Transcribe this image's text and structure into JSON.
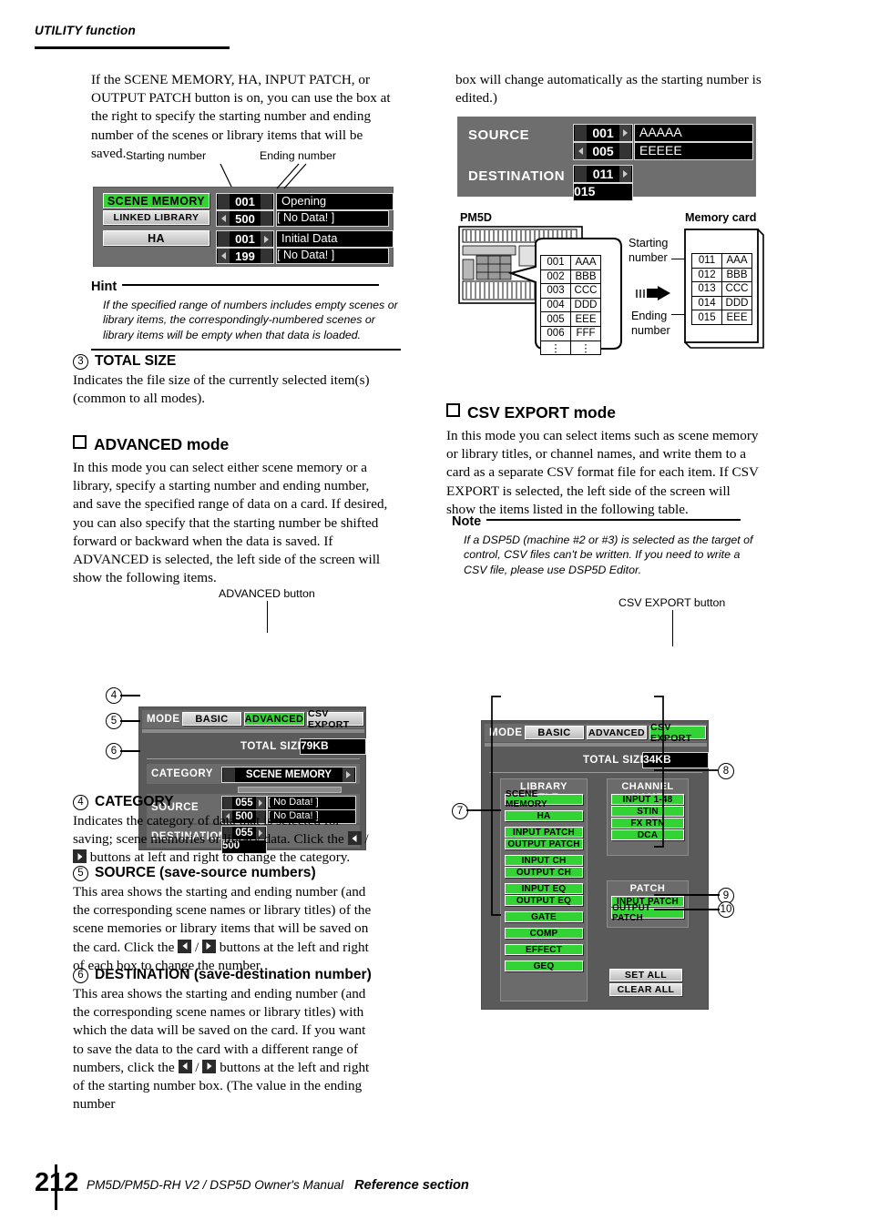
{
  "header": {
    "title": "UTILITY function"
  },
  "left": {
    "intro": "If the SCENE MEMORY, HA, INPUT PATCH, or OUTPUT PATCH button is on, you can use the box at the right to specify the starting number and ending number of the scenes or library items that will be saved.",
    "caption_start": "Starting number",
    "caption_end": "Ending number",
    "screen1": {
      "rows": [
        {
          "button": "SCENE MEMORY",
          "button_state": "on",
          "number": "001",
          "name": "Opening",
          "left_arrow": false,
          "right_arrow": false
        },
        {
          "button": "LINKED LIBRARY",
          "button_state": "off",
          "number": "500",
          "name": "[   No Data!   ]",
          "left_arrow": true,
          "right_arrow": false
        },
        {
          "button": "HA",
          "button_state": "off",
          "number": "001",
          "name": "Initial Data",
          "left_arrow": false,
          "right_arrow": true
        },
        {
          "button": "",
          "button_state": "none",
          "number": "199",
          "name": "[   No Data!   ]",
          "left_arrow": true,
          "right_arrow": false
        }
      ]
    },
    "hint": {
      "title": "Hint",
      "body": "If the specified range of numbers includes empty scenes or library items, the correspondingly-numbered scenes or library items will be empty when that data is loaded."
    },
    "item3": {
      "num": "3",
      "title": "TOTAL SIZE",
      "body": "Indicates the file size of the currently selected item(s) (common to all modes)."
    },
    "advanced": {
      "heading": "ADVANCED mode",
      "body": "In this mode you can select either scene memory or a library, specify a starting number and ending number, and save the specified range of data on a card. If desired, you can also specify that the starting number be shifted forward or backward when the data is saved. If ADVANCED is selected, the left side of the screen will show the following items."
    },
    "advanced_caption": "ADVANCED button",
    "screen2": {
      "mode_label": "MODE",
      "tabs": [
        {
          "label": "BASIC",
          "selected": false
        },
        {
          "label": "ADVANCED",
          "selected": true
        },
        {
          "label": "CSV EXPORT",
          "selected": false
        }
      ],
      "total_size_label": "TOTAL SIZE",
      "total_size_value": "79KB",
      "category_label": "CATEGORY",
      "category_value": "SCENE MEMORY",
      "source_label": "SOURCE",
      "source_rows": [
        {
          "number": "055",
          "name": "[   No Data!   ]",
          "left_arrow": false,
          "right_arrow": true
        },
        {
          "number": "500",
          "name": "[   No Data!   ]",
          "left_arrow": true,
          "right_arrow": false
        }
      ],
      "destination_label": "DESTINATION",
      "destination_rows": [
        {
          "number": "055",
          "left_arrow": false,
          "right_arrow": true
        },
        {
          "number": "500",
          "left_arrow": false,
          "right_arrow": false
        }
      ]
    },
    "callouts": {
      "c4": "4",
      "c5": "5",
      "c6": "6"
    },
    "item4": {
      "num": "4",
      "title": "CATEGORY",
      "body_a": "Indicates the category of data that is selected for saving; scene memories or library data. Click the",
      "body_b": "buttons at left and right to change the category."
    },
    "item5": {
      "num": "5",
      "title": "SOURCE (save-source numbers)",
      "body_a": "This area shows the starting and ending number (and the corresponding scene names or library titles) of the scene memories or library items that will be saved on the card. Click the",
      "body_b": "buttons at the left and right of each box to change the number."
    },
    "item6": {
      "num": "6",
      "title": "DESTINATION (save-destination number)",
      "body_a": "This area shows the starting and ending number (and the corresponding scene names or library titles) with which the data will be saved on the card. If you want to save the data to the card with a different range of numbers, click the",
      "body_b": "buttons at the left and right of the starting number box. (The value in the ending number"
    }
  },
  "right": {
    "intro": "box will change automatically as the starting number is edited.)",
    "screen3": {
      "source_label": "SOURCE",
      "source_rows": [
        {
          "number": "001",
          "name": "AAAAA",
          "left_arrow": false,
          "right_arrow": true
        },
        {
          "number": "005",
          "name": "EEEEE",
          "left_arrow": true,
          "right_arrow": false
        }
      ],
      "destination_label": "DESTINATION",
      "destination_rows": [
        {
          "number": "011",
          "left_arrow": false,
          "right_arrow": true
        },
        {
          "number": "015",
          "left_arrow": false,
          "right_arrow": false
        }
      ]
    },
    "diagram": {
      "pm5d_label": "PM5D",
      "card_label": "Memory card",
      "starting_label": "Starting\nnumber",
      "starting_label_l1": "Starting",
      "starting_label_l2": "number",
      "ending_label_l1": "Ending",
      "ending_label_l2": "number",
      "pm5d_table": [
        [
          "001",
          "AAA"
        ],
        [
          "002",
          "BBB"
        ],
        [
          "003",
          "CCC"
        ],
        [
          "004",
          "DDD"
        ],
        [
          "005",
          "EEE"
        ],
        [
          "006",
          "FFF"
        ],
        [
          "⋮",
          "⋮"
        ]
      ],
      "card_table": [
        [
          "011",
          "AAA"
        ],
        [
          "012",
          "BBB"
        ],
        [
          "013",
          "CCC"
        ],
        [
          "014",
          "DDD"
        ],
        [
          "015",
          "EEE"
        ]
      ]
    },
    "csv": {
      "heading": "CSV EXPORT mode",
      "body": "In this mode you can select items such as scene memory or library titles, or channel names, and write them to a card as a separate CSV format file for each item. If CSV EXPORT is selected, the left side of the screen will show the items listed in the following table."
    },
    "note": {
      "title": "Note",
      "body": "If a DSP5D (machine #2 or #3) is selected as the target of control, CSV files can't be written. If you need to write a CSV file, please use DSP5D Editor."
    },
    "csv_caption": "CSV EXPORT button",
    "screen4": {
      "mode_label": "MODE",
      "tabs": [
        {
          "label": "BASIC",
          "selected": false
        },
        {
          "label": "ADVANCED",
          "selected": false
        },
        {
          "label": "CSV EXPORT",
          "selected": true
        }
      ],
      "total_size_label": "TOTAL SIZE",
      "total_size_value": "34KB",
      "library_title_label": "LIBRARY TITLE",
      "library_items": [
        {
          "label": "SCENE MEMORY",
          "gap_after": true
        },
        {
          "label": "HA",
          "gap_after": true
        },
        {
          "label": "INPUT PATCH",
          "gap_after": false
        },
        {
          "label": "OUTPUT PATCH",
          "gap_after": true
        },
        {
          "label": "INPUT CH",
          "gap_after": false
        },
        {
          "label": "OUTPUT CH",
          "gap_after": true
        },
        {
          "label": "INPUT EQ",
          "gap_after": false
        },
        {
          "label": "OUTPUT EQ",
          "gap_after": true
        },
        {
          "label": "GATE",
          "gap_after": true
        },
        {
          "label": "COMP",
          "gap_after": true
        },
        {
          "label": "EFFECT",
          "gap_after": true
        },
        {
          "label": "GEQ",
          "gap_after": false
        }
      ],
      "channel_name_label": "CHANNEL NAME",
      "channel_items": [
        "INPUT 1-48",
        "STIN",
        "FX RTN",
        "DCA"
      ],
      "patch_label": "PATCH",
      "patch_items": [
        "INPUT PATCH",
        "OUTPUT PATCH"
      ],
      "set_all_label": "SET ALL",
      "clear_all_label": "CLEAR ALL"
    },
    "callouts": {
      "c7": "7",
      "c8": "8",
      "c9": "9",
      "c10": "10"
    }
  },
  "footer": {
    "page": "212",
    "manual": "PM5D/PM5D-RH V2 / DSP5D Owner's Manual",
    "section": "Reference section"
  }
}
